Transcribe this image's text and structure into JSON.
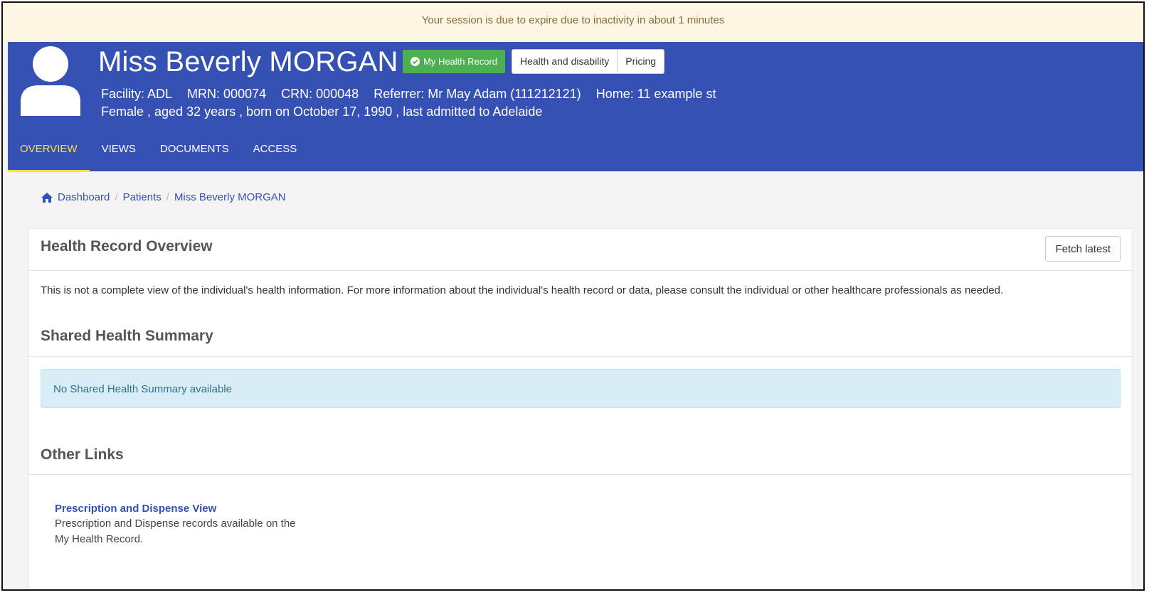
{
  "session": {
    "message": "Your session is due to expire due to inactivity in about 1 minutes"
  },
  "patient": {
    "name": "Miss Beverly MORGAN",
    "mhr_badge": "My Health Record",
    "buttons": [
      "Health and disability",
      "Pricing"
    ],
    "meta_line1": [
      "Facility: ADL",
      "MRN: 000074",
      "CRN: 000048",
      "Referrer: Mr May Adam (111212121)",
      "Home: 11 example st"
    ],
    "meta_line2": "Female , aged 32 years , born on October 17, 1990 , last admitted to Adelaide"
  },
  "tabs": [
    {
      "label": "OVERVIEW",
      "active": true
    },
    {
      "label": "VIEWS",
      "active": false
    },
    {
      "label": "DOCUMENTS",
      "active": false
    },
    {
      "label": "ACCESS",
      "active": false
    }
  ],
  "breadcrumb": [
    "Dashboard",
    "Patients",
    "Miss Beverly MORGAN"
  ],
  "card": {
    "title": "Health Record Overview",
    "fetch_label": "Fetch latest",
    "disclaimer": "This is not a complete view of the individual's health information. For more information about the individual's health record or data, please consult the individual or other healthcare professionals as needed.",
    "shared_summary": {
      "title": "Shared Health Summary",
      "empty_message": "No Shared Health Summary available"
    },
    "other_links": {
      "title": "Other Links",
      "items": [
        {
          "title": "Prescription and Dispense View",
          "description": "Prescription and Dispense records available on the My Health Record."
        }
      ]
    }
  },
  "colors": {
    "header_bg": "#3651b4",
    "active_tab": "#f5e048",
    "badge_green": "#4caf50",
    "banner_bg": "#fcf6e2"
  }
}
